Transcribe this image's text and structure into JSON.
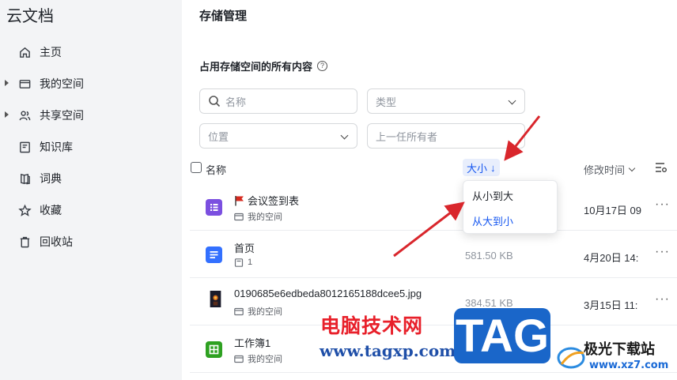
{
  "app_title": "云文档",
  "sidebar": {
    "items": [
      {
        "label": "主页",
        "icon": "home-icon",
        "expandable": false
      },
      {
        "label": "我的空间",
        "icon": "folder-icon",
        "expandable": true
      },
      {
        "label": "共享空间",
        "icon": "users-icon",
        "expandable": true
      },
      {
        "label": "知识库",
        "icon": "book-icon",
        "expandable": false
      },
      {
        "label": "词典",
        "icon": "dictionary-icon",
        "expandable": false
      },
      {
        "label": "收藏",
        "icon": "star-icon",
        "expandable": false
      },
      {
        "label": "回收站",
        "icon": "trash-icon",
        "expandable": false
      }
    ]
  },
  "main": {
    "title": "存储管理",
    "section_title": "占用存储空间的所有内容",
    "help_glyph": "?",
    "filters": {
      "search_placeholder": "名称",
      "type_placeholder": "类型",
      "location_placeholder": "位置",
      "owner_placeholder": "上一任所有者"
    },
    "table": {
      "col_name": "名称",
      "col_size": "大小",
      "col_size_arrow": "↓",
      "col_modified": "修改时间",
      "rows": [
        {
          "name": "会议签到表",
          "location": "我的空间",
          "size": "",
          "date": "10月17日 09",
          "type": "form",
          "flag": true
        },
        {
          "name": "首页",
          "location": "1",
          "size": "581.50 KB",
          "date": "4月20日 14:",
          "type": "doc",
          "flag": false
        },
        {
          "name": "0190685e6edbeda8012165188dcee5.jpg",
          "location": "我的空间",
          "size": "384.51 KB",
          "date": "3月15日 11:",
          "type": "image",
          "flag": false
        },
        {
          "name": "工作簿1",
          "location": "我的空间",
          "size": "",
          "date": "",
          "type": "sheet",
          "flag": false
        }
      ],
      "more_glyph": "···"
    },
    "sort_menu": {
      "options": [
        "从小到大",
        "从大到小"
      ],
      "selected": "从大到小"
    }
  },
  "watermarks": {
    "cn_text": "电脑技术网",
    "url": "www.tagxp.com",
    "tag": "TAG",
    "xz_title": "极光下载站",
    "xz_url": "www.xz7.com"
  },
  "colors": {
    "accent": "#1456f0",
    "sidebar_bg": "#f3f4f6",
    "arrow": "#d9262c",
    "form_icon": "#7b4fe0",
    "doc_icon": "#3370ff",
    "sheet_icon": "#2ea121"
  }
}
